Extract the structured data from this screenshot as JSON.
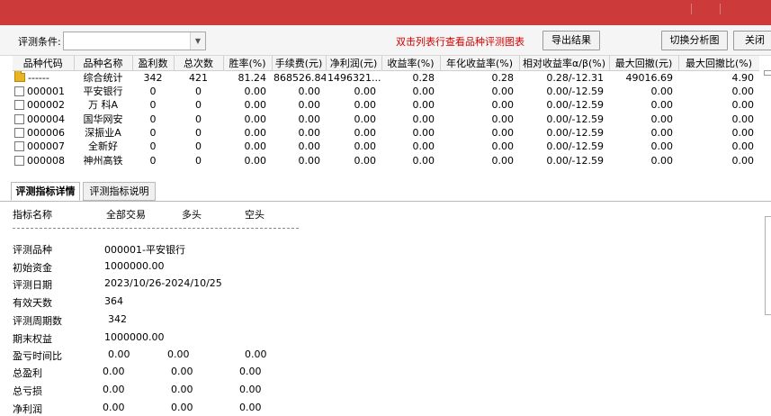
{
  "toolbar": {
    "condition_label": "评测条件:",
    "condition_value": "",
    "hint": "双击列表行查看品种评测图表",
    "export_label": "导出结果",
    "switch_label": "切换分析图",
    "close_label": "关闭"
  },
  "table": {
    "headers": [
      "品种代码",
      "品种名称",
      "盈利数",
      "总次数",
      "胜率(%)",
      "手续费(元)",
      "净利润(元)",
      "收益率(%)",
      "年化收益率(%)",
      "相对收益率α/β(%)",
      "最大回撤(元)",
      "最大回撤比(%)"
    ],
    "rows": [
      [
        "------",
        "综合统计",
        "342",
        "421",
        "81.24",
        "868526.84",
        "1496321...",
        "0.28",
        "0.28",
        "0.28/-12.31",
        "49016.69",
        "4.90"
      ],
      [
        "000001",
        "平安银行",
        "0",
        "0",
        "0.00",
        "0.00",
        "0.00",
        "0.00",
        "0.00",
        "0.00/-12.59",
        "0.00",
        "0.00"
      ],
      [
        "000002",
        "万 科A",
        "0",
        "0",
        "0.00",
        "0.00",
        "0.00",
        "0.00",
        "0.00",
        "0.00/-12.59",
        "0.00",
        "0.00"
      ],
      [
        "000004",
        "国华网安",
        "0",
        "0",
        "0.00",
        "0.00",
        "0.00",
        "0.00",
        "0.00",
        "0.00/-12.59",
        "0.00",
        "0.00"
      ],
      [
        "000006",
        "深振业A",
        "0",
        "0",
        "0.00",
        "0.00",
        "0.00",
        "0.00",
        "0.00",
        "0.00/-12.59",
        "0.00",
        "0.00"
      ],
      [
        "000007",
        "全新好",
        "0",
        "0",
        "0.00",
        "0.00",
        "0.00",
        "0.00",
        "0.00",
        "0.00/-12.59",
        "0.00",
        "0.00"
      ],
      [
        "000008",
        "神州高铁",
        "0",
        "0",
        "0.00",
        "0.00",
        "0.00",
        "0.00",
        "0.00",
        "0.00/-12.59",
        "0.00",
        "0.00"
      ]
    ]
  },
  "tabs": {
    "detail": "评测指标详情",
    "explain": "评测指标说明"
  },
  "detail": {
    "header_label": "指标名称",
    "col_all": "全部交易",
    "col_long": "多头",
    "col_short": "空头",
    "rows": [
      {
        "label": "评测品种",
        "all": "000001-平安银行",
        "long": "",
        "short": ""
      },
      {
        "label": "初始资金",
        "all": "1000000.00",
        "long": "",
        "short": ""
      },
      {
        "label": "评测日期",
        "all": "2023/10/26-2024/10/25",
        "long": "",
        "short": ""
      },
      {
        "label": "有效天数",
        "all": "364",
        "long": "",
        "short": ""
      },
      {
        "label": "评测周期数",
        "all": "342",
        "long": "",
        "short": ""
      },
      {
        "label": "期末权益",
        "all": "1000000.00",
        "long": "",
        "short": ""
      },
      {
        "label": "盈亏时间比",
        "all": "0.00",
        "long": "0.00",
        "short": "0.00"
      },
      {
        "label": "总盈利",
        "all": "0.00",
        "long": "0.00",
        "short": "0.00"
      },
      {
        "label": "总亏损",
        "all": "0.00",
        "long": "0.00",
        "short": "0.00"
      },
      {
        "label": "净利润",
        "all": "0.00",
        "long": "0.00",
        "short": "0.00"
      }
    ]
  },
  "colors": {
    "titlebar": "#cd3a3a",
    "hint": "#d40000"
  }
}
